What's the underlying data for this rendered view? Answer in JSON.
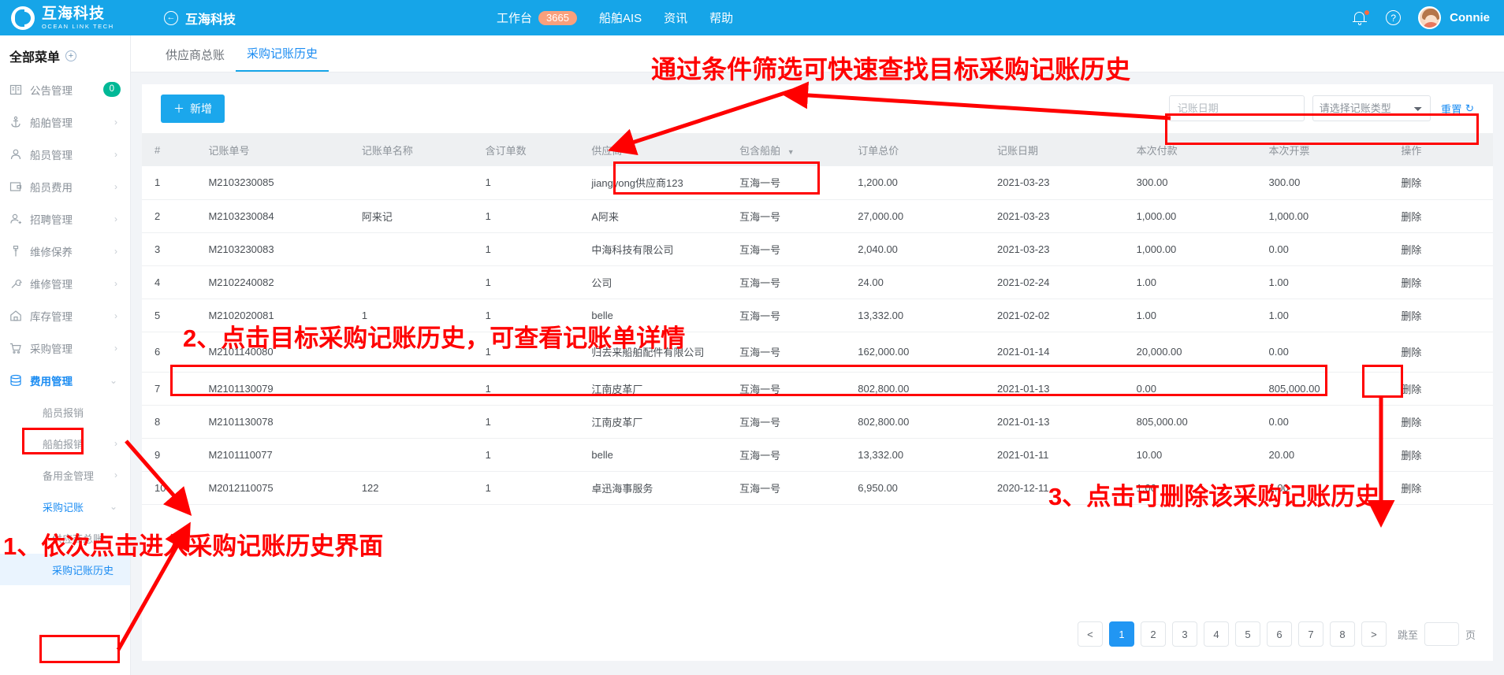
{
  "header": {
    "brand_cn": "互海科技",
    "brand_en": "OCEAN LINK TECH",
    "back_icon": "←",
    "back_title": "互海科技",
    "nav": [
      {
        "label": "工作台",
        "badge": "3665"
      },
      {
        "label": "船舶AIS",
        "badge": ""
      },
      {
        "label": "资讯",
        "badge": ""
      },
      {
        "label": "帮助",
        "badge": ""
      }
    ],
    "help_glyph": "?",
    "username": "Connie"
  },
  "sidebar": {
    "title": "全部菜单",
    "plus_glyph": "+",
    "items": [
      {
        "label": "公告管理",
        "icon": "book-icon",
        "badge": "0",
        "arrow": ""
      },
      {
        "label": "船舶管理",
        "icon": "anchor-icon",
        "badge": "",
        "arrow": "›"
      },
      {
        "label": "船员管理",
        "icon": "user-icon",
        "badge": "",
        "arrow": "›"
      },
      {
        "label": "船员费用",
        "icon": "wallet-icon",
        "badge": "",
        "arrow": "›"
      },
      {
        "label": "招聘管理",
        "icon": "user-plus-icon",
        "badge": "",
        "arrow": "›"
      },
      {
        "label": "维修保养",
        "icon": "wrench-tool-icon",
        "badge": "",
        "arrow": "›"
      },
      {
        "label": "维修管理",
        "icon": "wrench-icon",
        "badge": "",
        "arrow": "›"
      },
      {
        "label": "库存管理",
        "icon": "home-icon",
        "badge": "",
        "arrow": "›"
      },
      {
        "label": "采购管理",
        "icon": "cart-icon",
        "badge": "",
        "arrow": "›"
      },
      {
        "label": "费用管理",
        "icon": "database-icon",
        "badge": "",
        "arrow": "⌄"
      }
    ],
    "submenu": [
      {
        "label": "船员报销",
        "arrow": "",
        "level": 1,
        "state": "normal"
      },
      {
        "label": "船舶报销",
        "arrow": "›",
        "level": 1,
        "state": "normal"
      },
      {
        "label": "备用金管理",
        "arrow": "›",
        "level": 1,
        "state": "normal"
      },
      {
        "label": "采购记账",
        "arrow": "⌄",
        "level": 1,
        "state": "blue"
      },
      {
        "label": "供应商总账",
        "arrow": "",
        "level": 2,
        "state": "normal"
      },
      {
        "label": "采购记账历史",
        "arrow": "",
        "level": 2,
        "state": "selected"
      }
    ]
  },
  "tabs": [
    {
      "label": "供应商总账",
      "active": false
    },
    {
      "label": "采购记账历史",
      "active": true
    }
  ],
  "toolbar": {
    "add_label": "新增",
    "add_plus": "＋",
    "date_placeholder": "记账日期",
    "date_value": "",
    "type_selected": "请选择记账类型",
    "type_options": [
      "请选择记账类型"
    ],
    "reset_label": "重置",
    "reset_icon": "↻"
  },
  "table": {
    "columns": [
      {
        "label": "#",
        "sort": false
      },
      {
        "label": "记账单号",
        "sort": false
      },
      {
        "label": "记账单名称",
        "sort": false
      },
      {
        "label": "含订单数",
        "sort": false
      },
      {
        "label": "供应商",
        "sort": true
      },
      {
        "label": "包含船舶",
        "sort": true
      },
      {
        "label": "订单总价",
        "sort": false
      },
      {
        "label": "记账日期",
        "sort": false
      },
      {
        "label": "本次付款",
        "sort": false
      },
      {
        "label": "本次开票",
        "sort": false
      },
      {
        "label": "操作",
        "sort": false
      }
    ],
    "sort_caret": "▼",
    "rows": [
      {
        "no": "1",
        "order_no": "M2103230085",
        "name": "",
        "count": "1",
        "supplier": "jiangyong供应商123",
        "ship": "互海一号",
        "total": "1,200.00",
        "date": "2021-03-23",
        "paid": "300.00",
        "invoiced": "300.00",
        "action": "删除"
      },
      {
        "no": "2",
        "order_no": "M2103230084",
        "name": "阿来记",
        "count": "1",
        "supplier": "A阿来",
        "ship": "互海一号",
        "total": "27,000.00",
        "date": "2021-03-23",
        "paid": "1,000.00",
        "invoiced": "1,000.00",
        "action": "删除"
      },
      {
        "no": "3",
        "order_no": "M2103230083",
        "name": "",
        "count": "1",
        "supplier": "中海科技有限公司",
        "ship": "互海一号",
        "total": "2,040.00",
        "date": "2021-03-23",
        "paid": "1,000.00",
        "invoiced": "0.00",
        "action": "删除"
      },
      {
        "no": "4",
        "order_no": "M2102240082",
        "name": "",
        "count": "1",
        "supplier": "公司",
        "ship": "互海一号",
        "total": "24.00",
        "date": "2021-02-24",
        "paid": "1.00",
        "invoiced": "1.00",
        "action": "删除"
      },
      {
        "no": "5",
        "order_no": "M2102020081",
        "name": "1",
        "count": "1",
        "supplier": "belle",
        "ship": "互海一号",
        "total": "13,332.00",
        "date": "2021-02-02",
        "paid": "1.00",
        "invoiced": "1.00",
        "action": "删除"
      },
      {
        "no": "6",
        "order_no": "M2101140080",
        "name": "",
        "count": "1",
        "supplier": "归去来船舶配件有限公司",
        "ship": "互海一号",
        "total": "162,000.00",
        "date": "2021-01-14",
        "paid": "20,000.00",
        "invoiced": "0.00",
        "action": "删除"
      },
      {
        "no": "7",
        "order_no": "M2101130079",
        "name": "",
        "count": "1",
        "supplier": "江南皮革厂",
        "ship": "互海一号",
        "total": "802,800.00",
        "date": "2021-01-13",
        "paid": "0.00",
        "invoiced": "805,000.00",
        "action": "删除"
      },
      {
        "no": "8",
        "order_no": "M2101130078",
        "name": "",
        "count": "1",
        "supplier": "江南皮革厂",
        "ship": "互海一号",
        "total": "802,800.00",
        "date": "2021-01-13",
        "paid": "805,000.00",
        "invoiced": "0.00",
        "action": "删除"
      },
      {
        "no": "9",
        "order_no": "M2101110077",
        "name": "",
        "count": "1",
        "supplier": "belle",
        "ship": "互海一号",
        "total": "13,332.00",
        "date": "2021-01-11",
        "paid": "10.00",
        "invoiced": "20.00",
        "action": "删除"
      },
      {
        "no": "10",
        "order_no": "M2012110075",
        "name": "122",
        "count": "1",
        "supplier": "卓迅海事服务",
        "ship": "互海一号",
        "total": "6,950.00",
        "date": "2020-12-11",
        "paid": "1.00",
        "invoiced": "1.00",
        "action": "删除"
      }
    ]
  },
  "pagination": {
    "prev": "<",
    "next": ">",
    "pages": [
      "1",
      "2",
      "3",
      "4",
      "5",
      "6",
      "7",
      "8"
    ],
    "current": "1",
    "jump_label": "跳至",
    "jump_value": "",
    "jump_unit": "页"
  },
  "annotations": {
    "top": "通过条件筛选可快速查找目标采购记账历史",
    "step2": "2、点击目标采购记账历史，可查看记账单详情",
    "step3": "3、点击可删除该采购记账历史",
    "step1": "1、依次点击进入采购记账历史界面"
  },
  "colors": {
    "brand_blue": "#16a5e8",
    "accent_blue": "#1b8cf2",
    "annotation_red": "#ff0000",
    "badge_green": "#00b896",
    "badge_orange": "#f9a07c",
    "delete_pink": "#f3a3a3"
  }
}
